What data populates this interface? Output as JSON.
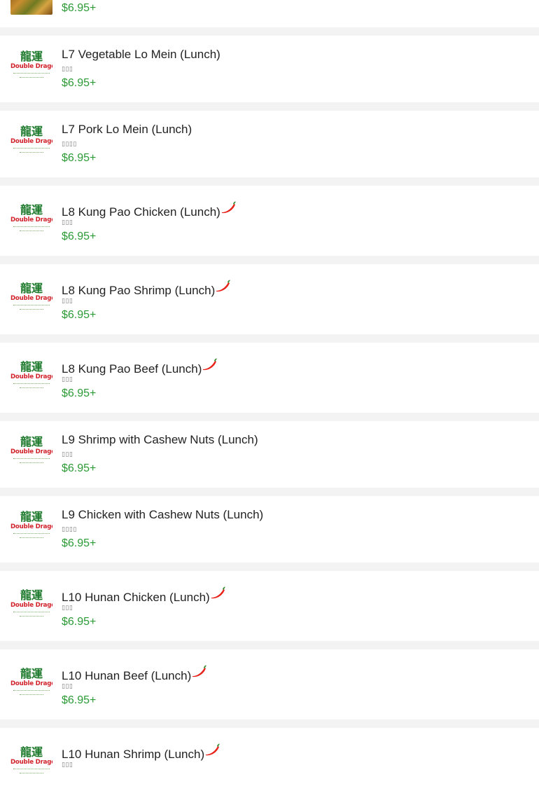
{
  "items": [
    {
      "name": "",
      "subtitle": "",
      "price": "$6.95+",
      "spicy": false,
      "thumb": "food-photo"
    },
    {
      "name": "L7 Vegetable Lo Mein (Lunch)",
      "subtitle": "▯▯▯",
      "price": "$6.95+",
      "spicy": false,
      "thumb": "restaurant-logo"
    },
    {
      "name": "L7 Pork Lo Mein (Lunch)",
      "subtitle": "▯▯▯▯",
      "price": "$6.95+",
      "spicy": false,
      "thumb": "restaurant-logo"
    },
    {
      "name": "L8 Kung Pao Chicken (Lunch)",
      "subtitle": "▯▯▯",
      "price": "$6.95+",
      "spicy": true,
      "thumb": "restaurant-logo"
    },
    {
      "name": "L8 Kung Pao Shrimp (Lunch)",
      "subtitle": "▯▯▯",
      "price": "$6.95+",
      "spicy": true,
      "thumb": "restaurant-logo"
    },
    {
      "name": "L8 Kung Pao Beef (Lunch)",
      "subtitle": "▯▯▯",
      "price": "$6.95+",
      "spicy": true,
      "thumb": "restaurant-logo"
    },
    {
      "name": "L9 Shrimp with Cashew Nuts (Lunch)",
      "subtitle": "▯▯▯",
      "price": "$6.95+",
      "spicy": false,
      "thumb": "restaurant-logo"
    },
    {
      "name": "L9 Chicken with Cashew Nuts (Lunch)",
      "subtitle": "▯▯▯▯",
      "price": "$6.95+",
      "spicy": false,
      "thumb": "restaurant-logo"
    },
    {
      "name": "L10 Hunan Chicken (Lunch)",
      "subtitle": "▯▯▯",
      "price": "$6.95+",
      "spicy": true,
      "thumb": "restaurant-logo"
    },
    {
      "name": "L10 Hunan Beef (Lunch)",
      "subtitle": "▯▯▯",
      "price": "$6.95+",
      "spicy": true,
      "thumb": "restaurant-logo"
    },
    {
      "name": "L10 Hunan Shrimp (Lunch)",
      "subtitle": "▯▯▯",
      "price": "",
      "spicy": true,
      "thumb": "restaurant-logo"
    }
  ],
  "logo": {
    "chinese": "龍運",
    "english": "Double Dragon II"
  },
  "colors": {
    "price": "#2b9a35",
    "logo_green": "#1e7a2c",
    "logo_red": "#d1222b",
    "chili": "#e8231b",
    "separator": "#f3f3f3"
  }
}
